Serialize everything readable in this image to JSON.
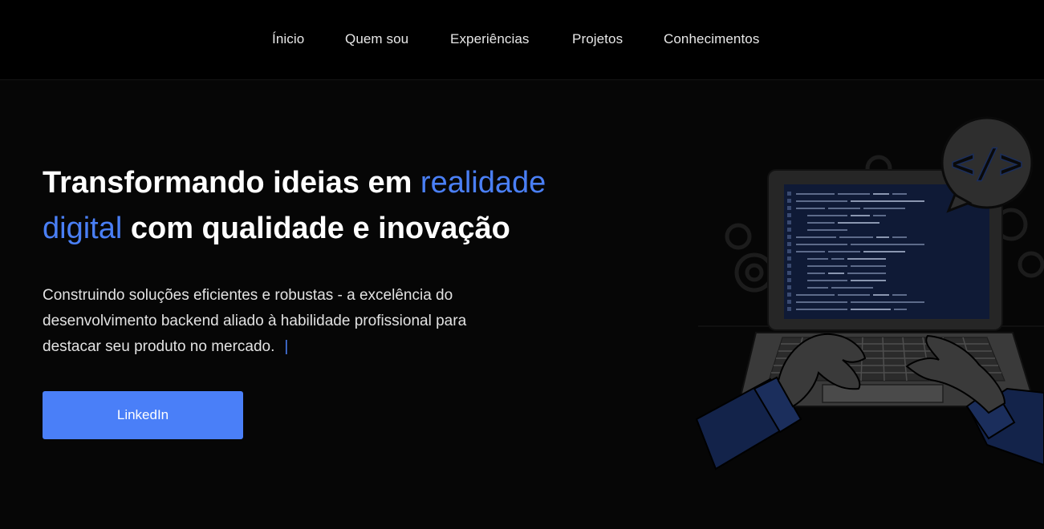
{
  "nav": {
    "items": [
      {
        "label": "Ínicio"
      },
      {
        "label": "Quem sou"
      },
      {
        "label": "Experiências"
      },
      {
        "label": "Projetos"
      },
      {
        "label": "Conhecimentos"
      }
    ]
  },
  "hero": {
    "title_part1": "Transformando ideias em ",
    "title_highlight1": "realidade",
    "title_highlight2": "digital",
    "title_part2": " com qualidade e inovação",
    "description": "Construindo soluções eficientes e robustas - a excelência do desenvolvimento backend aliado à habilidade profissional para destacar seu produto no mercado.",
    "cursor": "|",
    "button_label": "LinkedIn"
  },
  "illustration": {
    "code_bubble_text": "</>"
  },
  "colors": {
    "accent": "#4a7ff5",
    "background": "#060606",
    "nav_background": "#000000",
    "button": "#4a7ff8"
  },
  "icons": [
    "code-bubble-icon",
    "gear-icon",
    "laptop-illustration"
  ]
}
